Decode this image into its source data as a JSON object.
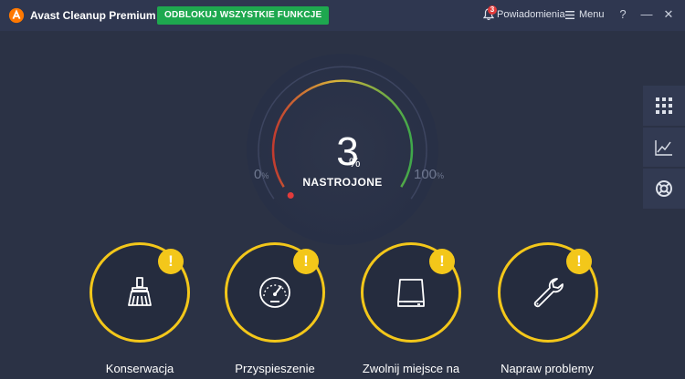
{
  "app": {
    "title": "Avast Cleanup Premium",
    "unlock_label": "ODBLOKUJ WSZYSTKIE FUNKCJE",
    "notifications_label": "Powiadomienia",
    "notifications_count": "3",
    "menu_label": "Menu",
    "help_glyph": "?",
    "minimize_glyph": "—",
    "close_glyph": "✕"
  },
  "gauge": {
    "value": "3",
    "value_fraction": 0.03,
    "unit": "%",
    "status": "NASTROJONE",
    "min": "0",
    "max": "100",
    "scale_unit": "%"
  },
  "side_panel": [
    {
      "icon": "grid-icon"
    },
    {
      "icon": "chart-icon"
    },
    {
      "icon": "lifebuoy-icon"
    }
  ],
  "tiles": [
    {
      "label": "Konserwacja",
      "icon": "broom-icon",
      "warning": "!"
    },
    {
      "label": "Przyspieszenie",
      "icon": "speedometer-icon",
      "warning": "!"
    },
    {
      "label": "Zwolnij miejsce na",
      "icon": "hard-drive-icon",
      "warning": "!"
    },
    {
      "label": "Napraw problemy",
      "icon": "wrench-icon",
      "warning": "!"
    }
  ],
  "colors": {
    "accent_yellow": "#f3c71a",
    "unlock_green": "#1ea84f",
    "background": "#2b3245",
    "logo_orange": "#ff7800"
  }
}
